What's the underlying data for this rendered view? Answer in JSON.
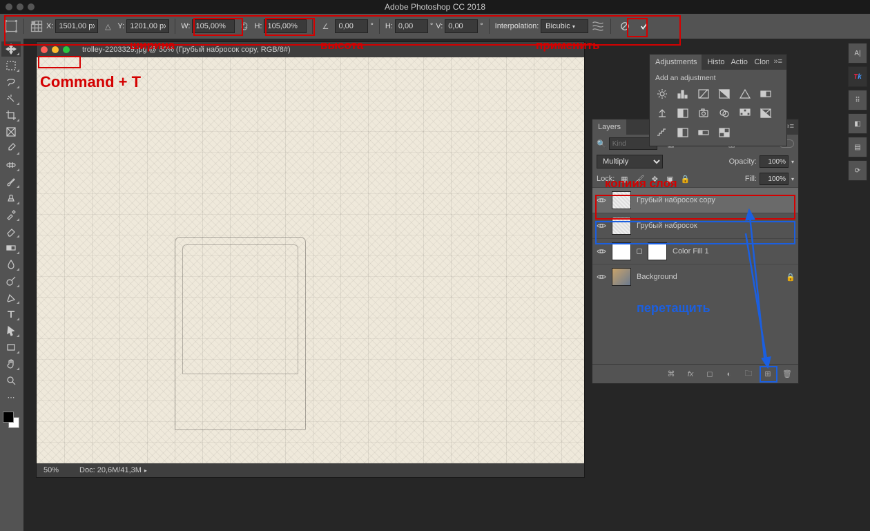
{
  "app_title": "Adobe Photoshop CC 2018",
  "options_bar": {
    "x_label": "X:",
    "x_value": "1501,00 px",
    "y_label": "Y:",
    "y_value": "1201,00 px",
    "w_label": "W:",
    "w_value": "105,00%",
    "h_label": "H:",
    "h_value": "105,00%",
    "rot_value": "0,00",
    "skew_h_label": "H:",
    "skew_h_value": "0,00",
    "skew_v_label": "V:",
    "skew_v_value": "0,00",
    "interp_label": "Interpolation:",
    "interp_value": "Bicubic"
  },
  "document": {
    "title": "trolley-2203329.jpg @ 50% (Грубый набросок copy, RGB/8#)",
    "zoom": "50%",
    "docsize": "Doc: 20,6M/41,3M"
  },
  "adjustments": {
    "tab": "Adjustments",
    "tab2": "Histo",
    "tab3": "Actio",
    "tab4": "Clon",
    "add_label": "Add an adjustment"
  },
  "layers": {
    "tab": "Layers",
    "search_placeholder": "Kind",
    "blend_mode": "Multiply",
    "opacity_label": "Opacity:",
    "opacity_value": "100%",
    "lock_label": "Lock:",
    "fill_label": "Fill:",
    "fill_value": "100%",
    "items": [
      {
        "name": "Грубый набросок copy"
      },
      {
        "name": "Грубый набросок"
      },
      {
        "name": "Color Fill 1"
      },
      {
        "name": "Background"
      }
    ]
  },
  "side_strip": [
    "A|",
    "TK",
    "⠿",
    "◧",
    "▤",
    "⟳"
  ],
  "annotations": {
    "command_t": "Command + T",
    "width": "ширина",
    "height": "высота",
    "apply": "применить",
    "layer_copy": "копиия слоя",
    "drag": "перетащить"
  }
}
